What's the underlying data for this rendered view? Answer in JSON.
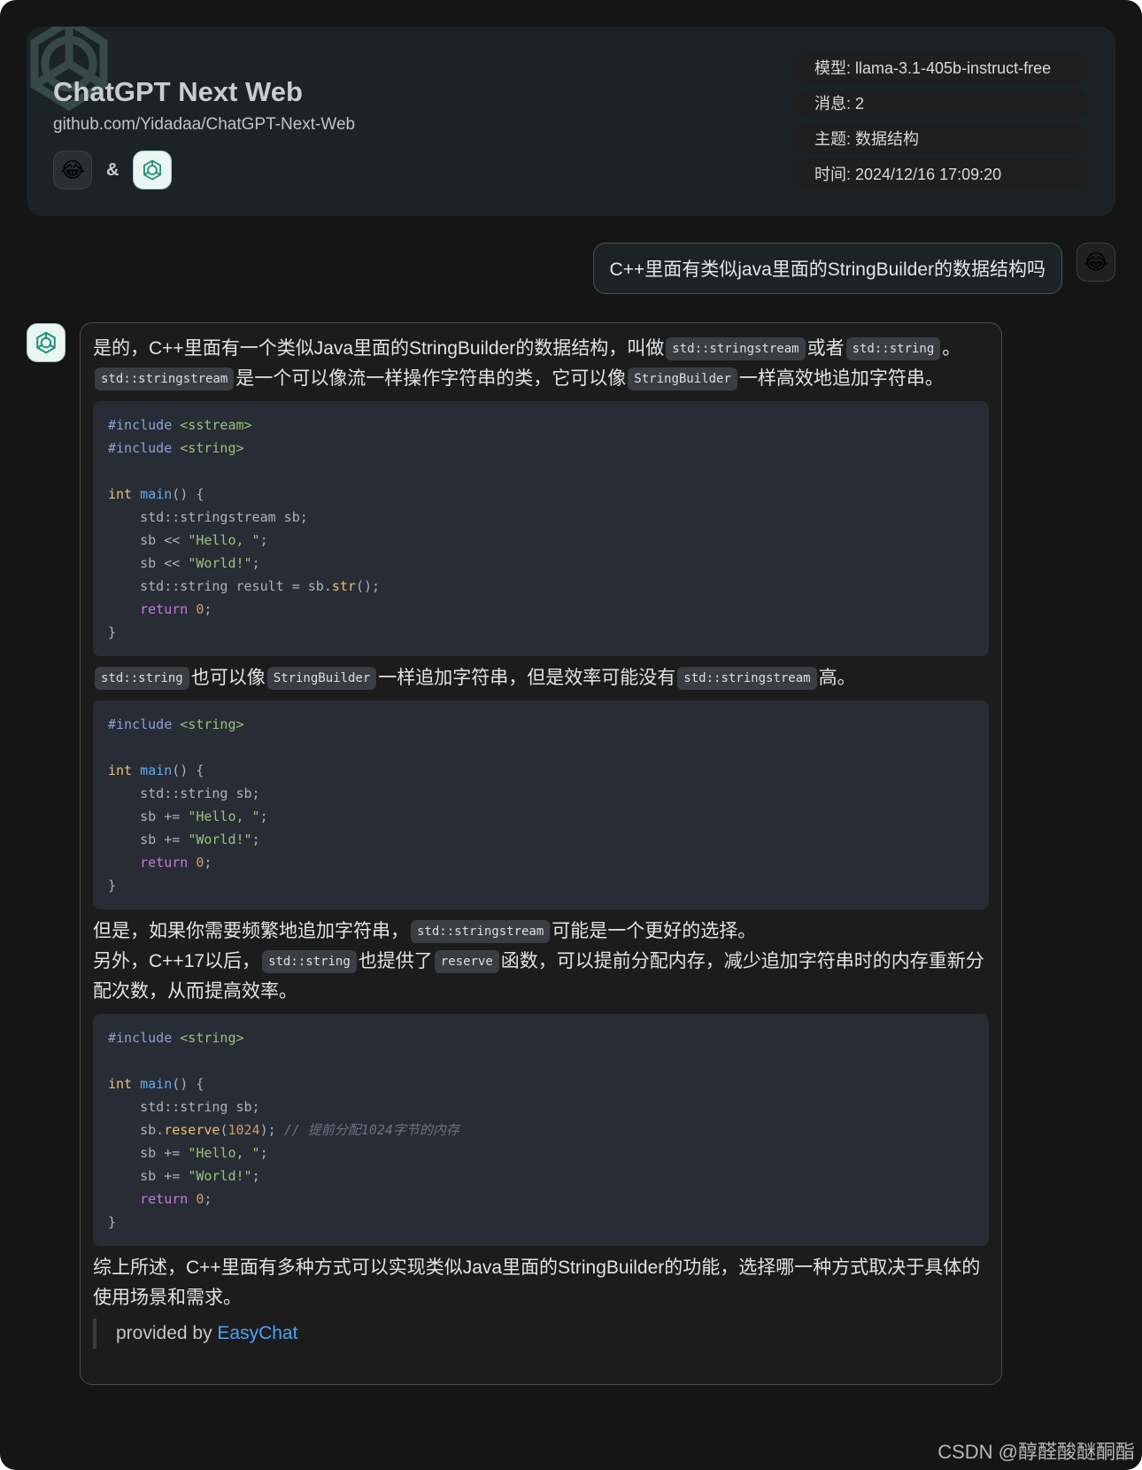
{
  "header": {
    "title": "ChatGPT Next Web",
    "subtitle": "github.com/Yidadaa/ChatGPT-Next-Web",
    "user_avatar_emoji": "😂",
    "separator": "&",
    "meta": {
      "model": "模型: llama-3.1-405b-instruct-free",
      "messages": "消息: 2",
      "topic": "主题: 数据结构",
      "time": "时间: 2024/12/16 17:09:20"
    }
  },
  "user_message": {
    "text": "C++里面有类似java里面的StringBuilder的数据结构吗",
    "avatar_emoji": "😂"
  },
  "bot_message": {
    "p1_a": "是的，C++里面有一个类似Java里面的StringBuilder的数据结构，叫做",
    "p1_code1": "std::stringstream",
    "p1_b": "或者",
    "p1_code2": "std::string",
    "p1_c": "。",
    "p2_code1": "std::stringstream",
    "p2_a": "是一个可以像流一样操作字符串的类，它可以像",
    "p2_code2": "StringBuilder",
    "p2_b": "一样高效地追加字符串。",
    "code1": {
      "l1_dir": "#include",
      "l1_hdr": "<sstream>",
      "l2_dir": "#include",
      "l2_hdr": "<string>",
      "l4_type": "int",
      "l4_fn": "main",
      "l4_rest": "() {",
      "l5": "    std::stringstream sb;",
      "l6_a": "    sb << ",
      "l6_str": "\"Hello, \"",
      "l6_end": ";",
      "l7_a": "    sb << ",
      "l7_str": "\"World!\"",
      "l7_end": ";",
      "l8_a": "    std::string result = sb.",
      "l8_fn": "str",
      "l8_end": "();",
      "l9_kw": "    return",
      "l9_num": "0",
      "l9_end": ";",
      "l10": "}"
    },
    "p3_code1": "std::string",
    "p3_a": "也可以像",
    "p3_code2": "StringBuilder",
    "p3_b": "一样追加字符串，但是效率可能没有",
    "p3_code3": "std::stringstream",
    "p3_c": "高。",
    "code2": {
      "l1_dir": "#include",
      "l1_hdr": "<string>",
      "l3_type": "int",
      "l3_fn": "main",
      "l3_rest": "() {",
      "l4": "    std::string sb;",
      "l5_a": "    sb += ",
      "l5_str": "\"Hello, \"",
      "l5_end": ";",
      "l6_a": "    sb += ",
      "l6_str": "\"World!\"",
      "l6_end": ";",
      "l7_kw": "    return",
      "l7_num": "0",
      "l7_end": ";",
      "l8": "}"
    },
    "p4_a": "但是，如果你需要频繁地追加字符串，",
    "p4_code": "std::stringstream",
    "p4_b": "可能是一个更好的选择。",
    "p5_a": "另外，C++17以后，",
    "p5_code1": "std::string",
    "p5_b": "也提供了",
    "p5_code2": "reserve",
    "p5_c": "函数，可以提前分配内存，减少追加字符串时的内存重新分配次数，从而提高效率。",
    "code3": {
      "l1_dir": "#include",
      "l1_hdr": "<string>",
      "l3_type": "int",
      "l3_fn": "main",
      "l3_rest": "() {",
      "l4": "    std::string sb;",
      "l5_a": "    sb.",
      "l5_fn": "reserve",
      "l5_b": "(",
      "l5_num": "1024",
      "l5_c": "); ",
      "l5_cm": "// 提前分配1024字节的内存",
      "l6_a": "    sb += ",
      "l6_str": "\"Hello, \"",
      "l6_end": ";",
      "l7_a": "    sb += ",
      "l7_str": "\"World!\"",
      "l7_end": ";",
      "l8_kw": "    return",
      "l8_num": "0",
      "l8_end": ";",
      "l9": "}"
    },
    "p6": "综上所述，C++里面有多种方式可以实现类似Java里面的StringBuilder的功能，选择哪一种方式取决于具体的使用场景和需求。",
    "provided_by": "provided by ",
    "provider_link": "EasyChat"
  },
  "watermark": "CSDN @醇醛酸醚酮酯"
}
